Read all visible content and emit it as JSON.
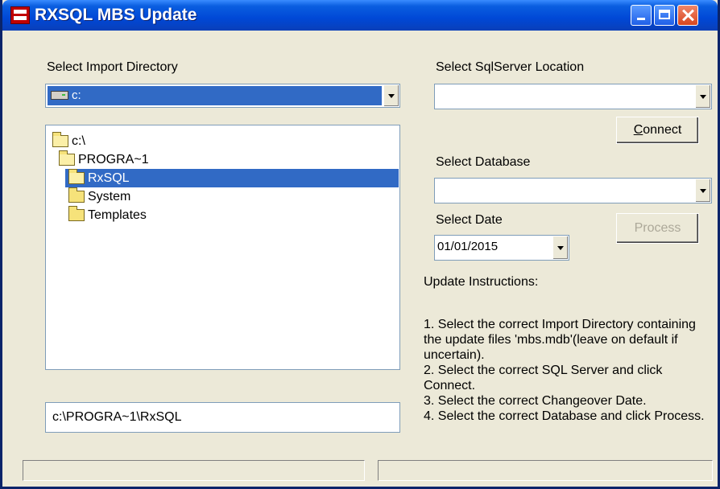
{
  "window": {
    "title": "RXSQL MBS Update"
  },
  "import_dir": {
    "label": "Select Import Directory",
    "drive_value": "c:",
    "tree": [
      {
        "label": "c:\\",
        "icon": "open-folder-icon",
        "selected": false
      },
      {
        "label": "PROGRA~1",
        "icon": "open-folder-icon",
        "selected": false
      },
      {
        "label": "RxSQL",
        "icon": "open-folder-icon",
        "selected": true
      },
      {
        "label": "System",
        "icon": "folder-icon",
        "selected": false
      },
      {
        "label": "Templates",
        "icon": "folder-icon",
        "selected": false
      }
    ],
    "path_value": "c:\\PROGRA~1\\RxSQL"
  },
  "sql_server": {
    "label": "Select SqlServer Location",
    "value": "",
    "connect_label": "Connect",
    "connect_mnemonic": "C"
  },
  "database": {
    "label": "Select Database",
    "value": ""
  },
  "date": {
    "label": "Select Date",
    "value": "01/01/2015"
  },
  "process": {
    "label": "Process",
    "enabled": false
  },
  "instructions": {
    "title": "Update Instructions:",
    "lines": [
      "1. Select the correct Import Directory containing the update files 'mbs.mdb'(leave on default if uncertain).",
      "2. Select the correct SQL Server and click Connect.",
      "3. Select the correct Changeover Date.",
      "4. Select the correct Database and click Process."
    ]
  },
  "status_bar": {
    "left": "",
    "right": ""
  }
}
